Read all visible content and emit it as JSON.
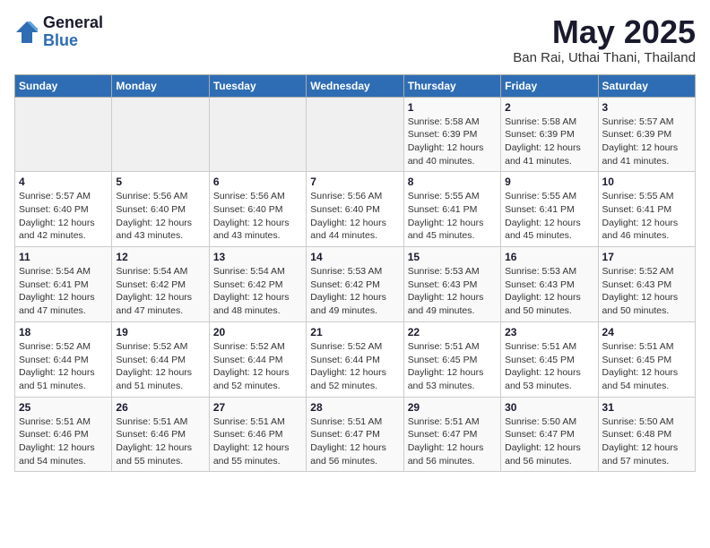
{
  "logo": {
    "general": "General",
    "blue": "Blue"
  },
  "title": "May 2025",
  "subtitle": "Ban Rai, Uthai Thani, Thailand",
  "weekdays": [
    "Sunday",
    "Monday",
    "Tuesday",
    "Wednesday",
    "Thursday",
    "Friday",
    "Saturday"
  ],
  "weeks": [
    [
      {
        "day": "",
        "detail": ""
      },
      {
        "day": "",
        "detail": ""
      },
      {
        "day": "",
        "detail": ""
      },
      {
        "day": "",
        "detail": ""
      },
      {
        "day": "1",
        "detail": "Sunrise: 5:58 AM\nSunset: 6:39 PM\nDaylight: 12 hours\nand 40 minutes."
      },
      {
        "day": "2",
        "detail": "Sunrise: 5:58 AM\nSunset: 6:39 PM\nDaylight: 12 hours\nand 41 minutes."
      },
      {
        "day": "3",
        "detail": "Sunrise: 5:57 AM\nSunset: 6:39 PM\nDaylight: 12 hours\nand 41 minutes."
      }
    ],
    [
      {
        "day": "4",
        "detail": "Sunrise: 5:57 AM\nSunset: 6:40 PM\nDaylight: 12 hours\nand 42 minutes."
      },
      {
        "day": "5",
        "detail": "Sunrise: 5:56 AM\nSunset: 6:40 PM\nDaylight: 12 hours\nand 43 minutes."
      },
      {
        "day": "6",
        "detail": "Sunrise: 5:56 AM\nSunset: 6:40 PM\nDaylight: 12 hours\nand 43 minutes."
      },
      {
        "day": "7",
        "detail": "Sunrise: 5:56 AM\nSunset: 6:40 PM\nDaylight: 12 hours\nand 44 minutes."
      },
      {
        "day": "8",
        "detail": "Sunrise: 5:55 AM\nSunset: 6:41 PM\nDaylight: 12 hours\nand 45 minutes."
      },
      {
        "day": "9",
        "detail": "Sunrise: 5:55 AM\nSunset: 6:41 PM\nDaylight: 12 hours\nand 45 minutes."
      },
      {
        "day": "10",
        "detail": "Sunrise: 5:55 AM\nSunset: 6:41 PM\nDaylight: 12 hours\nand 46 minutes."
      }
    ],
    [
      {
        "day": "11",
        "detail": "Sunrise: 5:54 AM\nSunset: 6:41 PM\nDaylight: 12 hours\nand 47 minutes."
      },
      {
        "day": "12",
        "detail": "Sunrise: 5:54 AM\nSunset: 6:42 PM\nDaylight: 12 hours\nand 47 minutes."
      },
      {
        "day": "13",
        "detail": "Sunrise: 5:54 AM\nSunset: 6:42 PM\nDaylight: 12 hours\nand 48 minutes."
      },
      {
        "day": "14",
        "detail": "Sunrise: 5:53 AM\nSunset: 6:42 PM\nDaylight: 12 hours\nand 49 minutes."
      },
      {
        "day": "15",
        "detail": "Sunrise: 5:53 AM\nSunset: 6:43 PM\nDaylight: 12 hours\nand 49 minutes."
      },
      {
        "day": "16",
        "detail": "Sunrise: 5:53 AM\nSunset: 6:43 PM\nDaylight: 12 hours\nand 50 minutes."
      },
      {
        "day": "17",
        "detail": "Sunrise: 5:52 AM\nSunset: 6:43 PM\nDaylight: 12 hours\nand 50 minutes."
      }
    ],
    [
      {
        "day": "18",
        "detail": "Sunrise: 5:52 AM\nSunset: 6:44 PM\nDaylight: 12 hours\nand 51 minutes."
      },
      {
        "day": "19",
        "detail": "Sunrise: 5:52 AM\nSunset: 6:44 PM\nDaylight: 12 hours\nand 51 minutes."
      },
      {
        "day": "20",
        "detail": "Sunrise: 5:52 AM\nSunset: 6:44 PM\nDaylight: 12 hours\nand 52 minutes."
      },
      {
        "day": "21",
        "detail": "Sunrise: 5:52 AM\nSunset: 6:44 PM\nDaylight: 12 hours\nand 52 minutes."
      },
      {
        "day": "22",
        "detail": "Sunrise: 5:51 AM\nSunset: 6:45 PM\nDaylight: 12 hours\nand 53 minutes."
      },
      {
        "day": "23",
        "detail": "Sunrise: 5:51 AM\nSunset: 6:45 PM\nDaylight: 12 hours\nand 53 minutes."
      },
      {
        "day": "24",
        "detail": "Sunrise: 5:51 AM\nSunset: 6:45 PM\nDaylight: 12 hours\nand 54 minutes."
      }
    ],
    [
      {
        "day": "25",
        "detail": "Sunrise: 5:51 AM\nSunset: 6:46 PM\nDaylight: 12 hours\nand 54 minutes."
      },
      {
        "day": "26",
        "detail": "Sunrise: 5:51 AM\nSunset: 6:46 PM\nDaylight: 12 hours\nand 55 minutes."
      },
      {
        "day": "27",
        "detail": "Sunrise: 5:51 AM\nSunset: 6:46 PM\nDaylight: 12 hours\nand 55 minutes."
      },
      {
        "day": "28",
        "detail": "Sunrise: 5:51 AM\nSunset: 6:47 PM\nDaylight: 12 hours\nand 56 minutes."
      },
      {
        "day": "29",
        "detail": "Sunrise: 5:51 AM\nSunset: 6:47 PM\nDaylight: 12 hours\nand 56 minutes."
      },
      {
        "day": "30",
        "detail": "Sunrise: 5:50 AM\nSunset: 6:47 PM\nDaylight: 12 hours\nand 56 minutes."
      },
      {
        "day": "31",
        "detail": "Sunrise: 5:50 AM\nSunset: 6:48 PM\nDaylight: 12 hours\nand 57 minutes."
      }
    ]
  ]
}
